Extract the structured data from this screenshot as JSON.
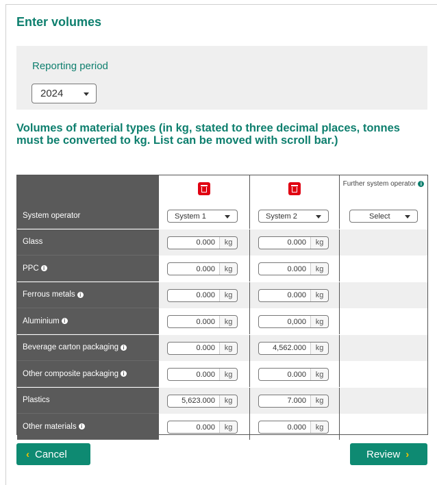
{
  "page": {
    "title": "Enter volumes"
  },
  "period": {
    "label": "Reporting period",
    "year": "2024"
  },
  "section": {
    "title": "Volumes of material types (in kg, stated to three decimal places, tonnes must be converted to kg. List can be moved with scroll bar.)"
  },
  "table": {
    "further_header": "Further system operator",
    "operator_label": "System operator",
    "operators": [
      "System 1",
      "System 2",
      "Select"
    ],
    "unit": "kg",
    "rows": [
      {
        "label": "Glass",
        "info": false,
        "v1": "0.000",
        "v2": "0.000"
      },
      {
        "label": "PPC",
        "info": true,
        "v1": "0.000",
        "v2": "0.000"
      },
      {
        "label": "Ferrous metals",
        "info": true,
        "v1": "0.000",
        "v2": "0.000"
      },
      {
        "label": "Aluminium",
        "info": true,
        "v1": "0.000",
        "v2": "0,000"
      },
      {
        "label": "Beverage carton packaging",
        "info": true,
        "v1": "0.000",
        "v2": "4,562.000"
      },
      {
        "label": "Other composite packaging",
        "info": true,
        "v1": "0.000",
        "v2": "0.000"
      },
      {
        "label": "Plastics",
        "info": false,
        "v1": "5,623.000",
        "v2": "7.000"
      },
      {
        "label": "Other materials",
        "info": true,
        "v1": "0.000",
        "v2": "0.000"
      }
    ]
  },
  "buttons": {
    "cancel": "Cancel",
    "review": "Review"
  },
  "colors": {
    "accent": "#0e7f6e",
    "button": "#0e8a72",
    "delete": "#e00012",
    "label_column": "#5a5a5a"
  }
}
